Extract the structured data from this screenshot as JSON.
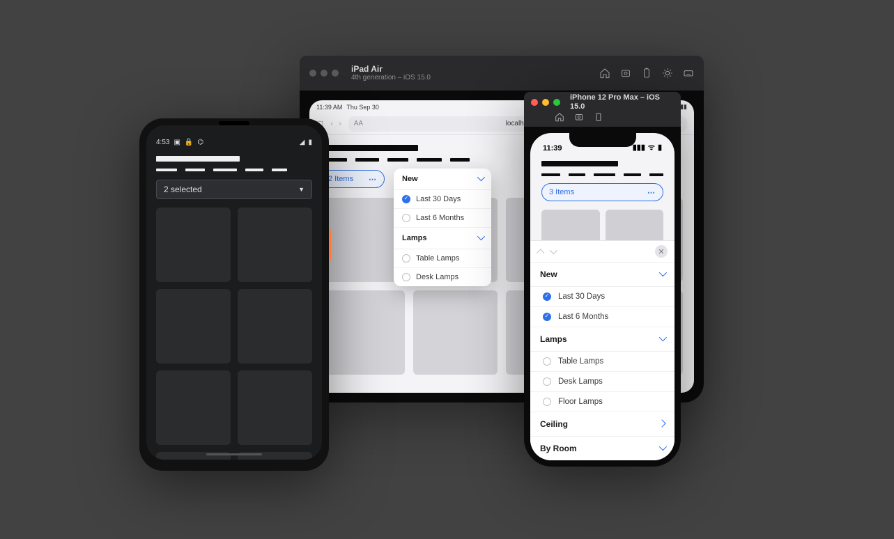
{
  "ipad": {
    "sim_title": "iPad Air",
    "sim_subtitle": "4th generation – iOS 15.0",
    "status_time": "11:39 AM",
    "status_date": "Thu Sep 30",
    "url_left": "AA",
    "url_text": "localhost",
    "items_label": "2 Items",
    "popover": {
      "section1": {
        "title": "New",
        "options": [
          "Last 30 Days",
          "Last 6 Months"
        ],
        "selected": [
          0
        ]
      },
      "section2": {
        "title": "Lamps",
        "options": [
          "Table Lamps",
          "Desk Lamps"
        ],
        "selected": []
      }
    }
  },
  "iphone": {
    "sim_title": "iPhone 12 Pro Max – iOS 15.0",
    "status_time": "11:39",
    "items_label": "3 Items",
    "sheet": {
      "section1": {
        "title": "New",
        "options": [
          "Last 30 Days",
          "Last 6 Months"
        ],
        "selected": [
          0,
          1
        ]
      },
      "section2": {
        "title": "Lamps",
        "options": [
          "Table Lamps",
          "Desk Lamps",
          "Floor Lamps"
        ],
        "selected": []
      },
      "section3": {
        "title": "Ceiling"
      },
      "section4": {
        "title": "By Room"
      }
    }
  },
  "android": {
    "status_time": "4:53",
    "select_label": "2 selected"
  }
}
